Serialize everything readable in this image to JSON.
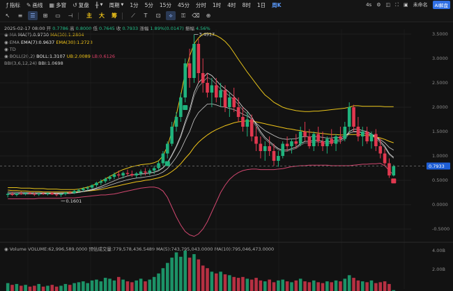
{
  "toolbar": {
    "items": [
      {
        "icon": "indicator-icon",
        "label": "指标"
      },
      {
        "icon": "draw-icon",
        "label": "画线"
      },
      {
        "icon": "multi-chart-icon",
        "label": "多窗"
      },
      {
        "icon": "replay-icon",
        "label": "复盘"
      }
    ],
    "period_label": "周期",
    "periods": [
      "1分",
      "5分",
      "15分",
      "45分",
      "分时",
      "1时",
      "4时",
      "8时",
      "1日",
      "周K"
    ],
    "selected_period": "周K",
    "right": {
      "a": "4s",
      "user": "未命名",
      "badge": "AI解盘"
    }
  },
  "subbar": {
    "y1": "主",
    "y2": "大",
    "y3": "筹"
  },
  "info": {
    "date": "2025-02-17 08:00",
    "open_l": "开",
    "open": "0.7786",
    "high_l": "高",
    "high": "0.8000",
    "low_l": "低",
    "low": "0.7645",
    "close_l": "收",
    "close": "0.7933",
    "chg_l": "涨幅",
    "chg": "1.89%(0.0147)",
    "amp_l": "振幅",
    "amp": "4.56%",
    "ma_l": "MA",
    "ma7": "MA(7):0.9730",
    "ma30": "MA(30):1.2804",
    "ema_l": "EMA",
    "ema7": "EMA(7):0.9637",
    "ema30": "EMA(30):1.2723",
    "td_l": "TD",
    "boll_l": "BOLL(20,2)",
    "boll": "BOLL:1.3107",
    "ub": "UB:2.0089",
    "lb": "LB:0.6126",
    "bbi_l": "BBI(3,6,12,24)",
    "bbi": "BBI:1.0698"
  },
  "volume": {
    "label": "Volume",
    "vol": "VOLUME:62,996,589.0000",
    "pred": "预估成交量:779,578,436.5489",
    "ma5": "MA(5):743,795,043.0000",
    "ma10": "MA(10):795,046,473.0000",
    "ticks": [
      "4.00B",
      "2.00B"
    ]
  },
  "chart_data": {
    "type": "candlestick",
    "ylim": [
      -0.7,
      3.6
    ],
    "y_ticks": [
      3.5,
      3.0,
      2.5,
      2.0,
      1.5,
      1.0,
      0.5,
      0.0,
      -0.5
    ],
    "y_tick_labels": [
      "3.5000",
      "3.0000",
      "2.5000",
      "2.0000",
      "1.5000",
      "1.0000",
      "0.5000",
      "0.0000",
      "-0.5000"
    ],
    "current_price": 0.7933,
    "current_label": "0.7933",
    "high_label": "3.4917",
    "high_value": 3.4917,
    "high_index": 42,
    "low_label": "0.1601",
    "low_value": 0.1601,
    "low_index": 12,
    "candles": [
      [
        0.2,
        0.25,
        0.15,
        0.22
      ],
      [
        0.22,
        0.26,
        0.18,
        0.2
      ],
      [
        0.2,
        0.24,
        0.17,
        0.23
      ],
      [
        0.23,
        0.27,
        0.2,
        0.22
      ],
      [
        0.22,
        0.25,
        0.19,
        0.24
      ],
      [
        0.24,
        0.27,
        0.21,
        0.22
      ],
      [
        0.22,
        0.25,
        0.18,
        0.21
      ],
      [
        0.21,
        0.24,
        0.18,
        0.23
      ],
      [
        0.23,
        0.26,
        0.2,
        0.22
      ],
      [
        0.22,
        0.25,
        0.19,
        0.24
      ],
      [
        0.24,
        0.27,
        0.2,
        0.21
      ],
      [
        0.21,
        0.23,
        0.17,
        0.2
      ],
      [
        0.2,
        0.23,
        0.16,
        0.22
      ],
      [
        0.22,
        0.26,
        0.19,
        0.25
      ],
      [
        0.25,
        0.28,
        0.22,
        0.24
      ],
      [
        0.24,
        0.3,
        0.22,
        0.28
      ],
      [
        0.28,
        0.33,
        0.25,
        0.3
      ],
      [
        0.3,
        0.36,
        0.27,
        0.33
      ],
      [
        0.33,
        0.38,
        0.29,
        0.35
      ],
      [
        0.35,
        0.42,
        0.32,
        0.4
      ],
      [
        0.4,
        0.47,
        0.36,
        0.45
      ],
      [
        0.45,
        0.52,
        0.4,
        0.48
      ],
      [
        0.48,
        0.56,
        0.44,
        0.53
      ],
      [
        0.53,
        0.6,
        0.49,
        0.57
      ],
      [
        0.57,
        0.66,
        0.52,
        0.62
      ],
      [
        0.62,
        0.7,
        0.55,
        0.6
      ],
      [
        0.6,
        0.68,
        0.54,
        0.65
      ],
      [
        0.65,
        0.72,
        0.58,
        0.63
      ],
      [
        0.63,
        0.7,
        0.57,
        0.6
      ],
      [
        0.6,
        0.67,
        0.55,
        0.64
      ],
      [
        0.64,
        0.72,
        0.58,
        0.68
      ],
      [
        0.68,
        0.75,
        0.6,
        0.66
      ],
      [
        0.66,
        0.74,
        0.6,
        0.7
      ],
      [
        0.7,
        0.8,
        0.63,
        0.75
      ],
      [
        0.75,
        0.9,
        0.7,
        0.85
      ],
      [
        0.85,
        1.1,
        0.8,
        1.05
      ],
      [
        1.05,
        1.3,
        0.95,
        1.25
      ],
      [
        1.25,
        1.7,
        1.2,
        1.6
      ],
      [
        1.6,
        1.9,
        1.5,
        1.8
      ],
      [
        1.8,
        2.3,
        1.7,
        2.2
      ],
      [
        2.2,
        3.0,
        2.1,
        2.9
      ],
      [
        2.9,
        3.2,
        2.4,
        2.6
      ],
      [
        2.6,
        3.49,
        2.5,
        3.3
      ],
      [
        3.3,
        3.4,
        2.5,
        2.7
      ],
      [
        2.7,
        3.0,
        2.3,
        2.5
      ],
      [
        2.5,
        2.7,
        2.2,
        2.3
      ],
      [
        2.3,
        2.6,
        2.0,
        2.45
      ],
      [
        2.45,
        2.6,
        2.1,
        2.2
      ],
      [
        2.2,
        2.5,
        2.0,
        2.35
      ],
      [
        2.35,
        2.45,
        1.9,
        2.0
      ],
      [
        2.0,
        2.3,
        1.8,
        2.2
      ],
      [
        2.2,
        2.4,
        1.9,
        2.0
      ],
      [
        2.0,
        2.2,
        1.7,
        1.8
      ],
      [
        1.8,
        2.0,
        1.5,
        1.6
      ],
      [
        1.6,
        1.9,
        1.4,
        1.75
      ],
      [
        1.75,
        1.85,
        1.3,
        1.4
      ],
      [
        1.4,
        1.6,
        1.1,
        1.25
      ],
      [
        1.25,
        1.4,
        0.95,
        1.1
      ],
      [
        1.1,
        1.3,
        0.9,
        1.2
      ],
      [
        1.2,
        1.4,
        1.0,
        1.1
      ],
      [
        1.1,
        1.25,
        0.8,
        0.9
      ],
      [
        0.9,
        1.1,
        0.78,
        1.0
      ],
      [
        1.0,
        1.3,
        0.95,
        1.25
      ],
      [
        1.25,
        1.4,
        1.1,
        1.2
      ],
      [
        1.2,
        1.35,
        1.05,
        1.3
      ],
      [
        1.3,
        1.45,
        1.15,
        1.25
      ],
      [
        1.25,
        1.6,
        1.2,
        1.5
      ],
      [
        1.5,
        1.7,
        1.3,
        1.4
      ],
      [
        1.4,
        1.55,
        1.15,
        1.2
      ],
      [
        1.2,
        1.5,
        1.1,
        1.45
      ],
      [
        1.45,
        1.6,
        1.2,
        1.3
      ],
      [
        1.3,
        1.5,
        1.1,
        1.2
      ],
      [
        1.2,
        1.4,
        1.05,
        1.35
      ],
      [
        1.35,
        1.55,
        1.2,
        1.25
      ],
      [
        1.25,
        1.45,
        1.1,
        1.4
      ],
      [
        1.4,
        1.6,
        1.25,
        1.35
      ],
      [
        1.35,
        1.7,
        1.3,
        1.6
      ],
      [
        1.6,
        2.1,
        1.5,
        2.0
      ],
      [
        2.0,
        2.05,
        1.5,
        1.6
      ],
      [
        1.6,
        1.8,
        1.3,
        1.4
      ],
      [
        1.4,
        1.6,
        1.2,
        1.5
      ],
      [
        1.5,
        1.6,
        1.25,
        1.3
      ],
      [
        1.3,
        1.5,
        1.15,
        1.45
      ],
      [
        1.45,
        1.55,
        1.1,
        1.2
      ],
      [
        1.2,
        1.35,
        0.95,
        1.05
      ],
      [
        1.05,
        1.15,
        0.8,
        0.85
      ],
      [
        0.85,
        0.95,
        0.55,
        0.6
      ],
      [
        0.6,
        0.82,
        0.58,
        0.79
      ]
    ],
    "ma7": [
      0.22,
      0.22,
      0.22,
      0.22,
      0.22,
      0.22,
      0.22,
      0.22,
      0.22,
      0.22,
      0.22,
      0.22,
      0.22,
      0.23,
      0.23,
      0.24,
      0.25,
      0.27,
      0.29,
      0.31,
      0.34,
      0.37,
      0.41,
      0.45,
      0.49,
      0.53,
      0.56,
      0.59,
      0.61,
      0.62,
      0.63,
      0.64,
      0.65,
      0.67,
      0.7,
      0.76,
      0.86,
      1.02,
      1.2,
      1.42,
      1.7,
      1.95,
      2.3,
      2.5,
      2.6,
      2.7,
      2.65,
      2.55,
      2.45,
      2.38,
      2.3,
      2.22,
      2.12,
      2.0,
      1.92,
      1.8,
      1.65,
      1.5,
      1.38,
      1.3,
      1.22,
      1.15,
      1.12,
      1.12,
      1.15,
      1.18,
      1.25,
      1.3,
      1.3,
      1.32,
      1.32,
      1.3,
      1.28,
      1.3,
      1.32,
      1.33,
      1.38,
      1.5,
      1.55,
      1.55,
      1.52,
      1.5,
      1.45,
      1.4,
      1.3,
      1.2,
      1.05,
      0.97
    ],
    "ema30": [
      0.3,
      0.29,
      0.29,
      0.28,
      0.28,
      0.27,
      0.27,
      0.27,
      0.26,
      0.26,
      0.26,
      0.26,
      0.26,
      0.26,
      0.26,
      0.26,
      0.27,
      0.27,
      0.28,
      0.29,
      0.3,
      0.31,
      0.33,
      0.35,
      0.37,
      0.39,
      0.41,
      0.43,
      0.45,
      0.47,
      0.48,
      0.5,
      0.51,
      0.53,
      0.55,
      0.58,
      0.62,
      0.68,
      0.75,
      0.84,
      0.95,
      1.05,
      1.18,
      1.28,
      1.36,
      1.43,
      1.49,
      1.54,
      1.58,
      1.62,
      1.65,
      1.68,
      1.7,
      1.71,
      1.72,
      1.71,
      1.7,
      1.68,
      1.66,
      1.64,
      1.62,
      1.6,
      1.58,
      1.56,
      1.55,
      1.53,
      1.52,
      1.5,
      1.49,
      1.48,
      1.47,
      1.46,
      1.45,
      1.44,
      1.44,
      1.43,
      1.43,
      1.44,
      1.44,
      1.44,
      1.43,
      1.42,
      1.41,
      1.39,
      1.37,
      1.34,
      1.3,
      1.27
    ],
    "ub": [
      0.35,
      0.35,
      0.35,
      0.34,
      0.34,
      0.34,
      0.33,
      0.33,
      0.33,
      0.32,
      0.32,
      0.32,
      0.31,
      0.31,
      0.31,
      0.31,
      0.32,
      0.34,
      0.36,
      0.39,
      0.43,
      0.48,
      0.53,
      0.58,
      0.63,
      0.68,
      0.72,
      0.75,
      0.78,
      0.8,
      0.82,
      0.83,
      0.84,
      0.86,
      0.9,
      1.0,
      1.2,
      1.5,
      1.85,
      2.25,
      2.7,
      3.05,
      3.3,
      3.42,
      3.5,
      3.52,
      3.5,
      3.47,
      3.42,
      3.35,
      3.25,
      3.12,
      2.98,
      2.85,
      2.72,
      2.6,
      2.48,
      2.36,
      2.25,
      2.18,
      2.1,
      2.05,
      2.0,
      1.97,
      1.95,
      1.93,
      1.92,
      1.91,
      1.91,
      1.92,
      1.92,
      1.93,
      1.94,
      1.95,
      1.96,
      1.97,
      1.98,
      2.0,
      2.03,
      2.03,
      2.02,
      2.02,
      2.02,
      2.02,
      2.02,
      2.01,
      2.01,
      2.01
    ],
    "lb": [
      0.12,
      0.12,
      0.12,
      0.12,
      0.12,
      0.12,
      0.12,
      0.13,
      0.13,
      0.13,
      0.13,
      0.13,
      0.13,
      0.14,
      0.14,
      0.14,
      0.15,
      0.16,
      0.17,
      0.18,
      0.19,
      0.2,
      0.2,
      0.21,
      0.22,
      0.24,
      0.26,
      0.28,
      0.3,
      0.32,
      0.34,
      0.35,
      0.36,
      0.36,
      0.34,
      0.28,
      0.15,
      -0.05,
      -0.25,
      -0.42,
      -0.55,
      -0.62,
      -0.65,
      -0.6,
      -0.5,
      -0.35,
      -0.15,
      0.05,
      0.25,
      0.4,
      0.52,
      0.6,
      0.66,
      0.7,
      0.72,
      0.73,
      0.73,
      0.72,
      0.72,
      0.72,
      0.72,
      0.73,
      0.74,
      0.76,
      0.78,
      0.79,
      0.8,
      0.8,
      0.81,
      0.81,
      0.81,
      0.81,
      0.81,
      0.8,
      0.8,
      0.8,
      0.8,
      0.8,
      0.81,
      0.82,
      0.83,
      0.83,
      0.84,
      0.84,
      0.85,
      0.8,
      0.7,
      0.61
    ],
    "volumes": [
      0.9,
      0.7,
      0.8,
      0.6,
      0.7,
      0.5,
      0.6,
      0.8,
      0.5,
      0.6,
      0.7,
      0.5,
      0.6,
      0.8,
      0.7,
      0.9,
      1.0,
      1.1,
      0.9,
      1.2,
      1.3,
      1.1,
      1.5,
      1.4,
      1.2,
      1.6,
      1.3,
      1.1,
      1.0,
      1.2,
      1.4,
      1.1,
      1.3,
      1.6,
      2.0,
      2.6,
      3.2,
      3.8,
      4.4,
      3.9,
      4.6,
      3.8,
      4.2,
      3.6,
      2.9,
      2.6,
      2.2,
      2.0,
      2.2,
      1.9,
      1.8,
      1.6,
      1.5,
      1.6,
      1.4,
      1.3,
      1.5,
      1.2,
      1.1,
      1.3,
      1.0,
      1.2,
      1.3,
      1.1,
      1.0,
      1.2,
      1.4,
      1.1,
      1.0,
      1.2,
      1.0,
      0.9,
      1.1,
      1.0,
      1.2,
      1.1,
      1.4,
      1.8,
      1.5,
      1.2,
      1.1,
      1.0,
      1.2,
      0.9,
      1.0,
      1.1,
      0.8,
      0.1
    ]
  }
}
